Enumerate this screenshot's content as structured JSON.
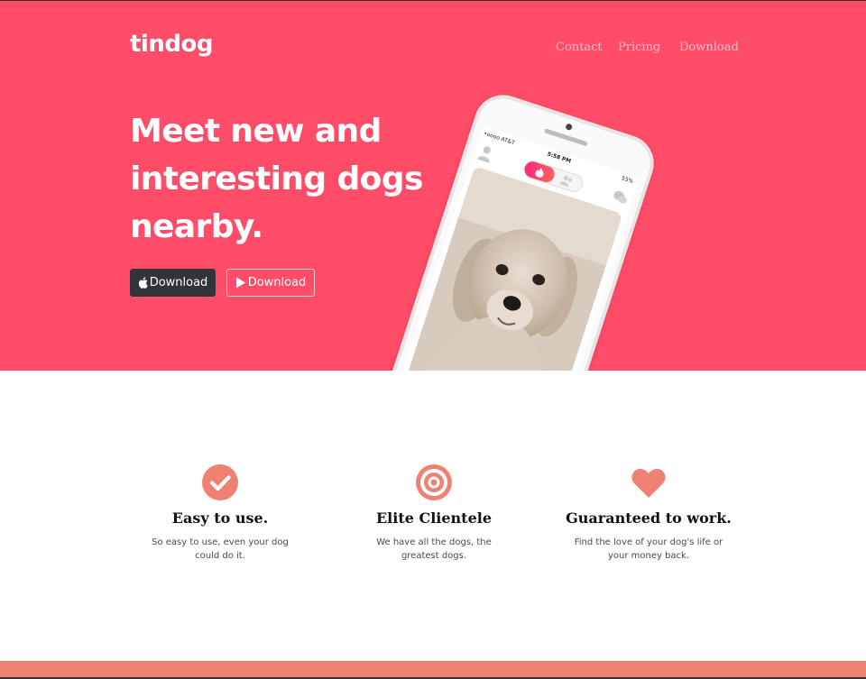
{
  "brand": {
    "name": "tindog"
  },
  "nav": {
    "items": [
      "Contact",
      "Pricing",
      "Download"
    ]
  },
  "hero": {
    "headline_lines": [
      "Meet new and",
      "interesting dogs",
      "nearby."
    ],
    "buttons": {
      "apple_label": "Download",
      "play_label": "Download"
    }
  },
  "phone": {
    "carrier": "•oooo AT&T",
    "time": "5:58 PM",
    "battery": "55%"
  },
  "features": [
    {
      "icon": "check-circle-icon",
      "title": "Easy to use.",
      "lines": [
        "So easy to use, even your dog",
        "could do it."
      ]
    },
    {
      "icon": "bullseye-icon",
      "title": "Elite Clientele",
      "lines": [
        "We have all the dogs, the",
        "greatest dogs."
      ]
    },
    {
      "icon": "heart-icon",
      "title": "Guaranteed to work.",
      "lines": [
        "Find the love of your dog's life or",
        "your money back."
      ]
    }
  ],
  "colors": {
    "hero_bg": "#ff4c68",
    "accent": "#ef8172",
    "dark_button": "#33333a",
    "text": "#111111"
  }
}
